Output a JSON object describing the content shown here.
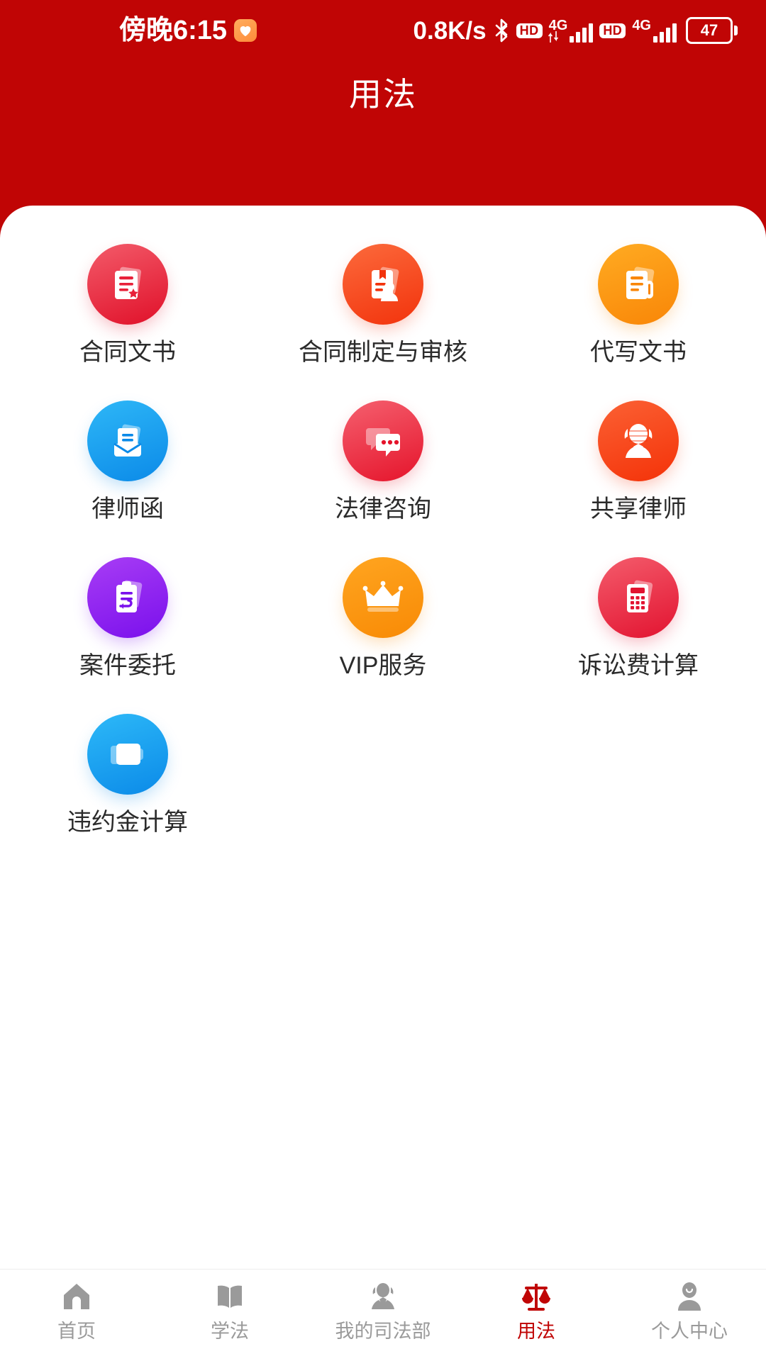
{
  "status_bar": {
    "time": "傍晚6:15",
    "app_badge_icon": "health-heart-icon",
    "network_speed": "0.8K/s",
    "bluetooth_icon": "bluetooth-icon",
    "hd_badge_1": "HD",
    "sim1_network": "4G",
    "hd_badge_2": "HD",
    "sim2_network": "4G",
    "battery_percent": "47"
  },
  "header": {
    "title": "用法",
    "background_color": "#c00505"
  },
  "services": [
    {
      "label": "合同文书",
      "icon": "contract-document-star-icon",
      "color_start": "#f35b6a",
      "color_end": "#e01029"
    },
    {
      "label": "合同制定与审核",
      "icon": "contract-review-person-icon",
      "color_start": "#fc6a3c",
      "color_end": "#f2330c"
    },
    {
      "label": "代写文书",
      "icon": "ghostwrite-document-pen-icon",
      "color_start": "#ffab22",
      "color_end": "#f98607"
    },
    {
      "label": "律师函",
      "icon": "lawyer-letter-envelope-icon",
      "color_start": "#2eb7f7",
      "color_end": "#0b8ae8"
    },
    {
      "label": "法律咨询",
      "icon": "chat-bubbles-icon",
      "color_start": "#f5606f",
      "color_end": "#e5142b"
    },
    {
      "label": "共享律师",
      "icon": "judge-person-icon",
      "color_start": "#fb6134",
      "color_end": "#f43208"
    },
    {
      "label": "案件委托",
      "icon": "case-clipboard-arrow-icon",
      "color_start": "#a83df5",
      "color_end": "#7a10ec"
    },
    {
      "label": "VIP服务",
      "icon": "crown-icon",
      "color_start": "#ffa520",
      "color_end": "#f88a05"
    },
    {
      "label": "诉讼费计算",
      "icon": "calculator-icon",
      "color_start": "#f45c6c",
      "color_end": "#e21330"
    },
    {
      "label": "违约金计算",
      "icon": "wallet-icon",
      "color_start": "#2db9f8",
      "color_end": "#0b8ae8"
    }
  ],
  "bottom_nav": {
    "active_index": 3,
    "active_color": "#c00505",
    "inactive_color": "#9a9a9a",
    "items": [
      {
        "label": "首页",
        "icon": "home-icon"
      },
      {
        "label": "学法",
        "icon": "book-icon"
      },
      {
        "label": "我的司法部",
        "icon": "judge-icon"
      },
      {
        "label": "用法",
        "icon": "scales-icon"
      },
      {
        "label": "个人中心",
        "icon": "person-icon"
      }
    ]
  }
}
